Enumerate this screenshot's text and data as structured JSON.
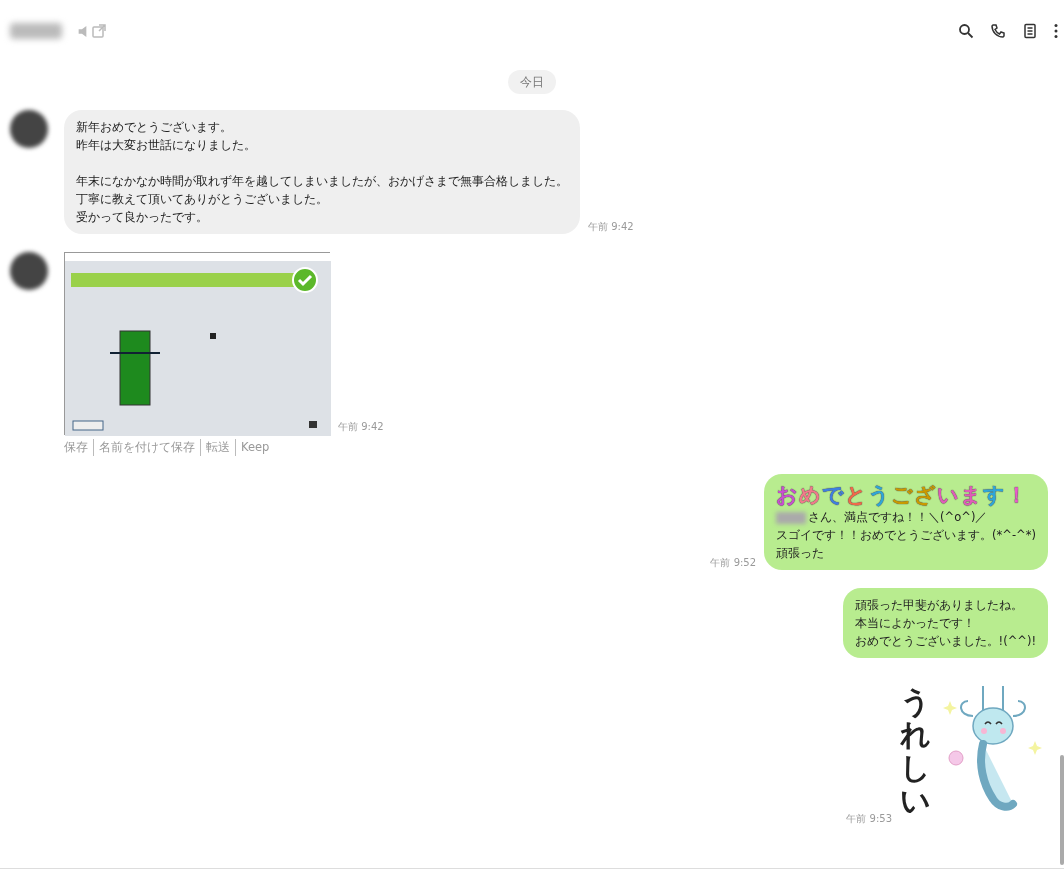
{
  "date_chip": "今日",
  "messages": [
    {
      "kind": "text",
      "outgoing": false,
      "paragraphs": [
        [
          "新年おめでとうございます。",
          "昨年は大変お世話になりました。"
        ],
        [
          "年末になかなか時間が取れず年を越してしまいましたが、おかげさまで無事合格しました。",
          "丁寧に教えて頂いてありがとうございました。",
          "受かって良かったです。"
        ]
      ],
      "time": "午前 9:42"
    },
    {
      "kind": "image",
      "outgoing": false,
      "time": "午前 9:42",
      "actions": [
        "保存",
        "名前を付けて保存",
        "転送",
        "Keep"
      ]
    },
    {
      "kind": "decorated",
      "outgoing": true,
      "title": [
        {
          "text": "お",
          "color": "#c94fd0"
        },
        {
          "text": "め",
          "color": "#f07a8a"
        },
        {
          "text": "で",
          "color": "#3f7fe0"
        },
        {
          "text": "と",
          "color": "#f06a4a"
        },
        {
          "text": "う",
          "color": "#2fa6d8"
        },
        {
          "text": "ご",
          "color": "#c99a00"
        },
        {
          "text": "ざ",
          "color": "#c99a00"
        },
        {
          "text": "い",
          "color": "#e05cb8"
        },
        {
          "text": "ま",
          "color": "#e05cb8"
        },
        {
          "text": "す",
          "color": "#2fa6d8"
        },
        {
          "text": "！",
          "color": "#e85cc8"
        }
      ],
      "lines": [
        "さん、満点ですね！！＼(^o^)／",
        "スゴイです！！おめでとうございます。(*^-^*)",
        "頑張った"
      ],
      "time": "午前 9:52"
    },
    {
      "kind": "text",
      "outgoing": true,
      "paragraphs": [
        [
          "頑張った甲斐がありましたね。",
          "本当によかったです！",
          "おめでとうございました。!(^^)!"
        ]
      ]
    },
    {
      "kind": "sticker",
      "outgoing": true,
      "caption": "うれしい",
      "time": "午前 9:53"
    }
  ]
}
